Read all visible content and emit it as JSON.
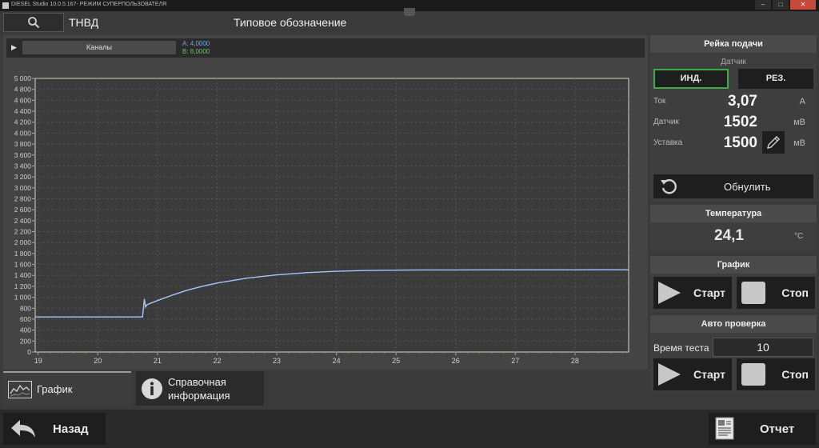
{
  "window": {
    "title": "DIESEL Studio 10.0.5.167- РЕЖИМ СУПЕРПОЛЬЗОВАТЕЛЯ",
    "controls": [
      "–",
      "□",
      "✕"
    ]
  },
  "header": {
    "search_icon": "magnifier-icon",
    "unit_name": "ТНВД",
    "type_label": "Типовое обозначение"
  },
  "channels": {
    "label": "Каналы",
    "a_value": "A: 4,0000",
    "b_value": "B: 8,0000"
  },
  "chart_data": {
    "type": "line",
    "title": "",
    "xlabel": "",
    "ylabel": "",
    "xlim": [
      18.95,
      28.9
    ],
    "ylim": [
      0,
      5000
    ],
    "x_ticks": [
      19,
      20,
      21,
      22,
      23,
      24,
      25,
      26,
      27,
      28
    ],
    "y_ticks": [
      "0",
      "200",
      "400",
      "600",
      "800",
      "1 000",
      "1 200",
      "1 400",
      "1 600",
      "1 800",
      "2 000",
      "2 200",
      "2 400",
      "2 600",
      "2 800",
      "3 000",
      "3 200",
      "3 400",
      "3 600",
      "3 800",
      "4 000",
      "4 200",
      "4 400",
      "4 600",
      "4 800",
      "5 000"
    ],
    "grid": true,
    "series": [
      {
        "color": "#a8c4ff",
        "x": [
          18.95,
          19.5,
          20.0,
          20.5,
          20.75,
          20.78,
          20.8,
          20.82,
          20.86,
          21.0,
          21.25,
          21.5,
          21.75,
          22.0,
          22.5,
          23.0,
          23.5,
          24.0,
          24.5,
          25.0,
          25.5,
          26.0,
          26.5,
          27.0,
          27.5,
          28.0,
          28.5,
          28.9
        ],
        "y": [
          640,
          640,
          640,
          640,
          640,
          970,
          820,
          860,
          880,
          940,
          1040,
          1130,
          1200,
          1260,
          1350,
          1410,
          1450,
          1475,
          1490,
          1495,
          1500,
          1500,
          1502,
          1502,
          1502,
          1502,
          1503,
          1502
        ]
      }
    ]
  },
  "tabs": [
    {
      "label": "График",
      "icon": "chart-icon"
    },
    {
      "label_line1": "Справочная",
      "label_line2": "информация",
      "icon": "info-icon"
    }
  ],
  "footer": {
    "back_label": "Назад",
    "report_label": "Отчет"
  },
  "rack": {
    "title": "Рейка подачи",
    "sensor_label": "Датчик",
    "btn_ind": "ИНД.",
    "btn_rez": "РЕЗ.",
    "current": {
      "key": "Ток",
      "value": "3,07",
      "unit": "А"
    },
    "sensor": {
      "key": "Датчик",
      "value": "1502",
      "unit": "мВ"
    },
    "setpoint": {
      "key": "Уставка",
      "value": "1500",
      "unit": "мВ"
    },
    "reset_label": "Обнулить"
  },
  "temperature": {
    "title": "Температура",
    "value": "24,1",
    "unit": "°C"
  },
  "graph_ctrl": {
    "title": "График",
    "start": "Старт",
    "stop": "Стоп"
  },
  "auto_check": {
    "title": "Авто проверка",
    "time_label": "Время теста",
    "time_value": "10",
    "start": "Старт",
    "stop": "Стоп"
  }
}
